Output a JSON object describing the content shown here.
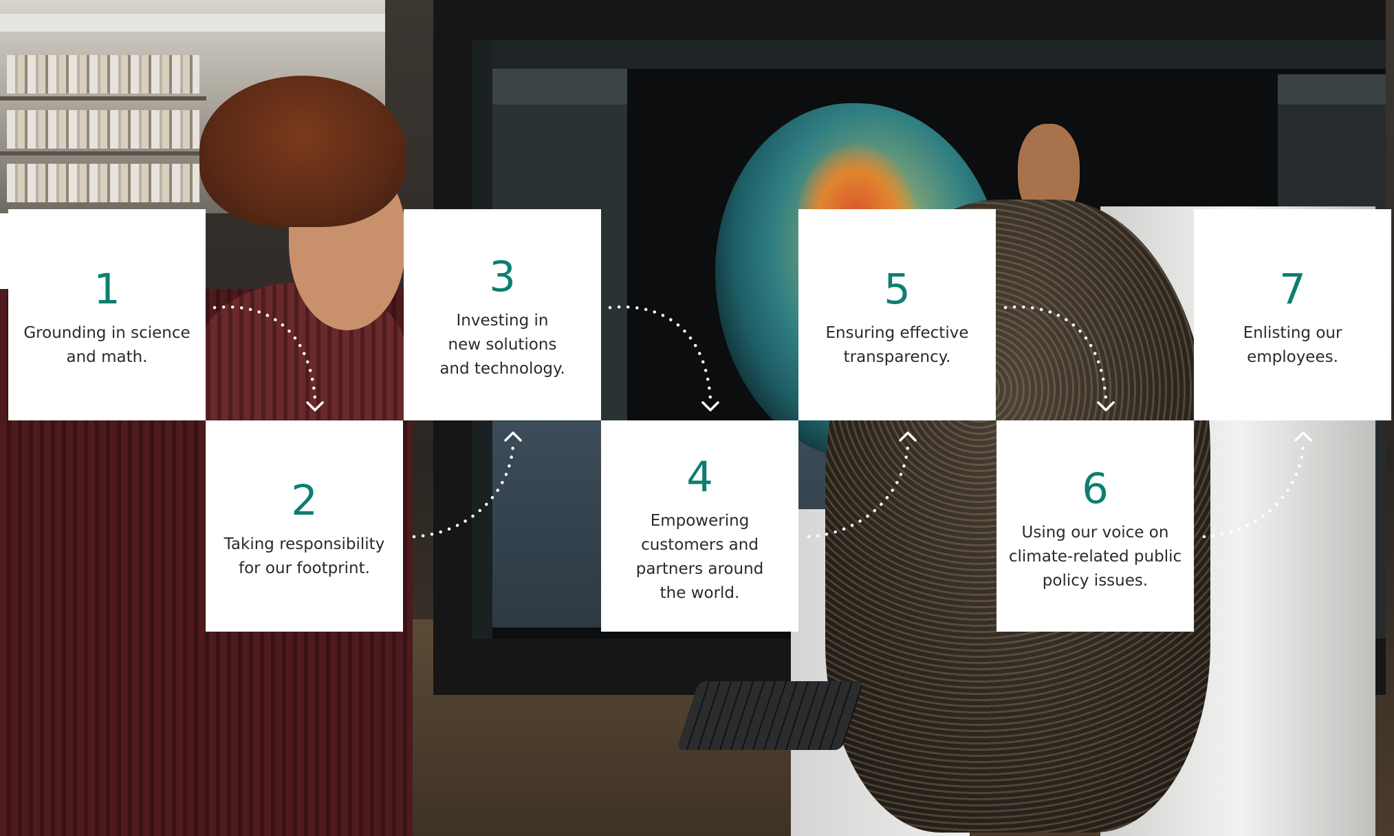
{
  "principles": [
    {
      "number": "1",
      "text": "Grounding in science\nand math."
    },
    {
      "number": "2",
      "text": "Taking responsibility\nfor our footprint."
    },
    {
      "number": "3",
      "text": "Investing in\nnew solutions\nand technology."
    },
    {
      "number": "4",
      "text": "Empowering\ncustomers and\npartners around\nthe world."
    },
    {
      "number": "5",
      "text": "Ensuring effective\ntransparency."
    },
    {
      "number": "6",
      "text": "Using our voice on\nclimate-related public\npolicy issues."
    },
    {
      "number": "7",
      "text": "Enlisting our\nemployees."
    }
  ],
  "colors": {
    "number_accent": "#0d7f72",
    "card_background": "#ffffff",
    "connector": "#ffffff"
  },
  "icons": {
    "connector": "dotted-curve-arrow-icon"
  }
}
